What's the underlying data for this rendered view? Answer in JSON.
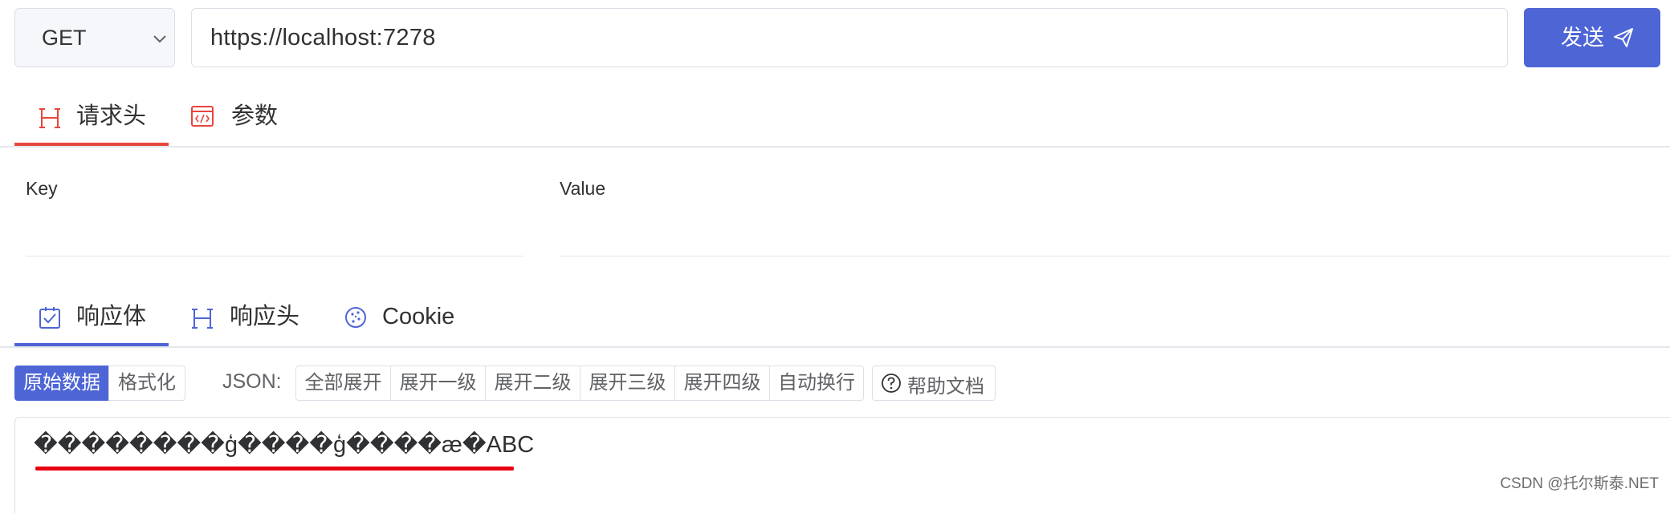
{
  "request": {
    "method": "GET",
    "url": "https://localhost:7278",
    "send_label": "发送"
  },
  "request_tabs": [
    {
      "label": "请求头",
      "icon": "heading-icon",
      "active": true
    },
    {
      "label": "参数",
      "icon": "code-window-icon",
      "active": false
    }
  ],
  "headers_table": {
    "key_label": "Key",
    "value_label": "Value"
  },
  "response_tabs": [
    {
      "label": "响应体",
      "icon": "checkbox-icon",
      "active": true
    },
    {
      "label": "响应头",
      "icon": "heading-icon",
      "active": false
    },
    {
      "label": "Cookie",
      "icon": "cookie-icon",
      "active": false
    }
  ],
  "toolbar": {
    "raw_label": "原始数据",
    "format_label": "格式化",
    "json_label": "JSON:",
    "expand_all": "全部展开",
    "expand_1": "展开一级",
    "expand_2": "展开二级",
    "expand_3": "展开三级",
    "expand_4": "展开四级",
    "auto_wrap": "自动换行",
    "help_docs": "帮助文档"
  },
  "response_body": {
    "text": "��������ģ����ģ����æ�ABC"
  },
  "watermark": "CSDN @托尔斯泰.NET",
  "colors": {
    "primary": "#4e65d6",
    "request_tab_accent": "#e8453c",
    "underline_red": "#e60012"
  }
}
